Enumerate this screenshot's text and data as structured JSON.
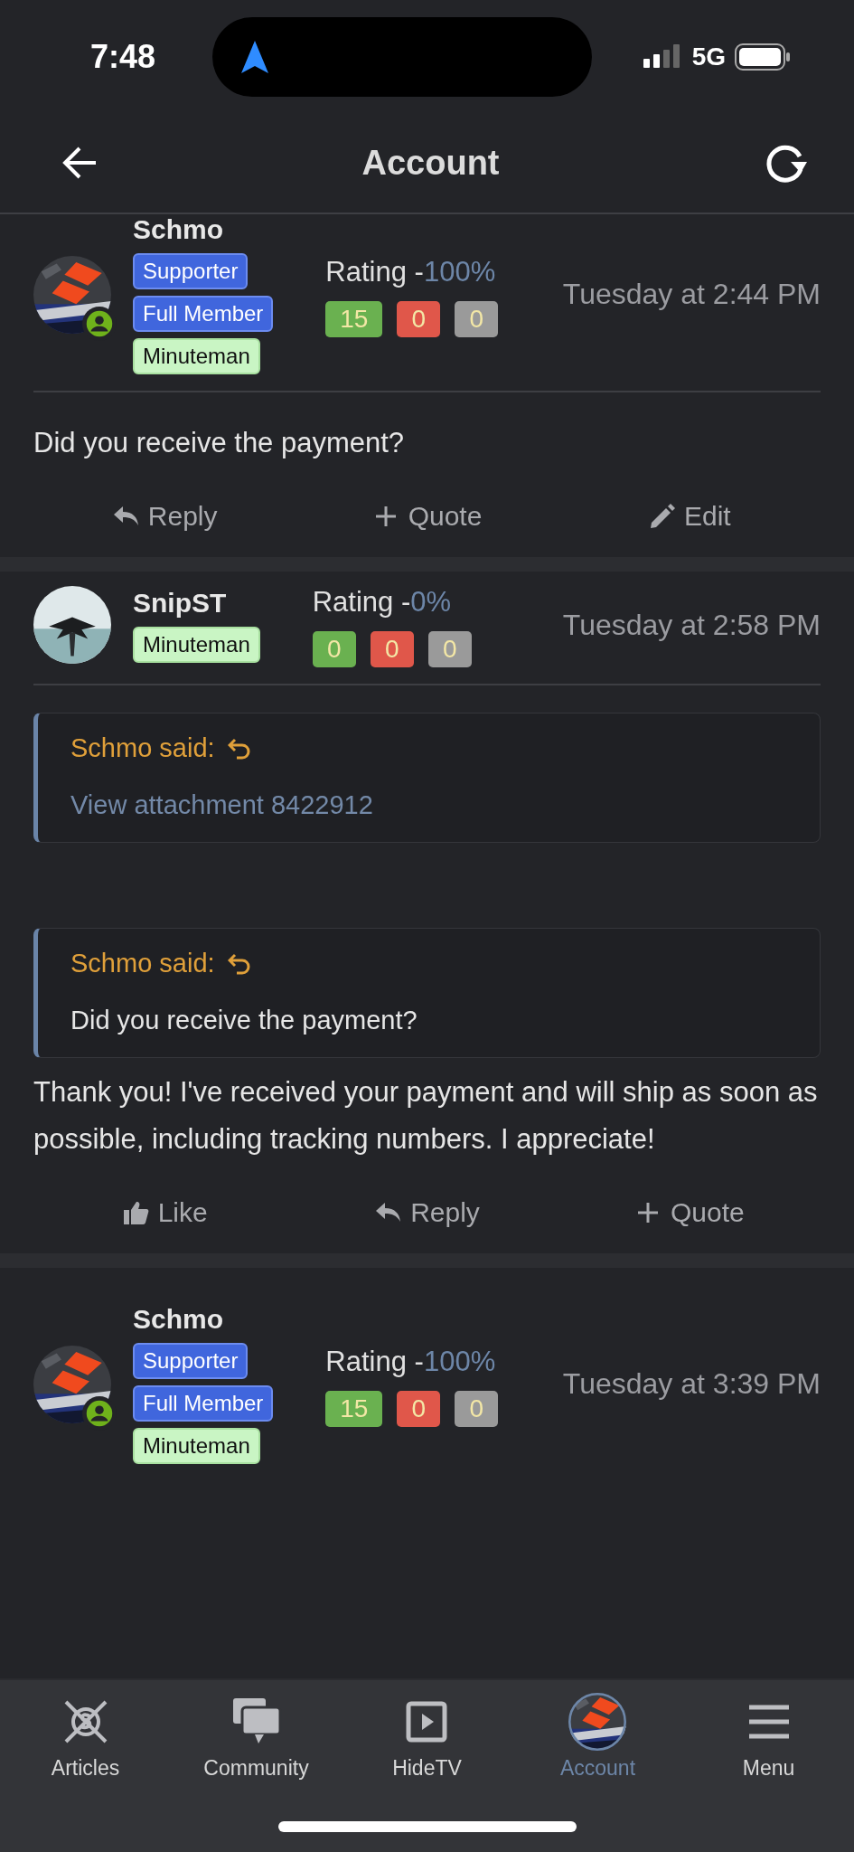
{
  "status_bar": {
    "time": "7:48",
    "network": "5G"
  },
  "header": {
    "title": "Account"
  },
  "posts": [
    {
      "author": "Schmo",
      "online": true,
      "badges": [
        {
          "label": "Supporter",
          "kind": "primary"
        },
        {
          "label": "Full Member",
          "kind": "primary"
        },
        {
          "label": "Minuteman",
          "kind": "light"
        }
      ],
      "rating": {
        "label": "Rating -",
        "value": "100%"
      },
      "counts": [
        {
          "value": "15",
          "kind": "positive"
        },
        {
          "value": "0",
          "kind": "negative"
        },
        {
          "value": "0",
          "kind": "neutral"
        }
      ],
      "time": "Tuesday at 2:44 PM",
      "body": [
        {
          "kind": "text",
          "text": "Did you receive the payment?"
        }
      ],
      "actions": [
        {
          "label": "Reply",
          "kind": "reply"
        },
        {
          "label": "Quote",
          "kind": "quote"
        },
        {
          "label": "Edit",
          "kind": "edit"
        }
      ]
    },
    {
      "author": "SnipST",
      "online": false,
      "badges": [
        {
          "label": "Minuteman",
          "kind": "light"
        }
      ],
      "rating": {
        "label": "Rating -",
        "value": "0%"
      },
      "counts": [
        {
          "value": "0",
          "kind": "positive"
        },
        {
          "value": "0",
          "kind": "negative"
        },
        {
          "value": "0",
          "kind": "neutral"
        }
      ],
      "time": "Tuesday at 2:58 PM",
      "body": [
        {
          "kind": "quote",
          "author": "Schmo said:",
          "link": "View attachment 8422912"
        },
        {
          "kind": "spacer"
        },
        {
          "kind": "quote",
          "author": "Schmo said:",
          "text": "Did you receive the payment?"
        },
        {
          "kind": "text",
          "text": "Thank you! I've received your payment and will ship as soon as possible, including tracking numbers. I appreciate!"
        }
      ],
      "actions": [
        {
          "label": "Like",
          "kind": "like"
        },
        {
          "label": "Reply",
          "kind": "reply"
        },
        {
          "label": "Quote",
          "kind": "quote"
        }
      ]
    },
    {
      "author": "Schmo",
      "online": true,
      "badges": [
        {
          "label": "Supporter",
          "kind": "primary"
        },
        {
          "label": "Full Member",
          "kind": "primary"
        },
        {
          "label": "Minuteman",
          "kind": "light"
        }
      ],
      "rating": {
        "label": "Rating -",
        "value": "100%"
      },
      "counts": [
        {
          "value": "15",
          "kind": "positive"
        },
        {
          "value": "0",
          "kind": "negative"
        },
        {
          "value": "0",
          "kind": "neutral"
        }
      ],
      "time": "Tuesday at 3:39 PM"
    }
  ],
  "tab_bar": [
    {
      "label": "Articles",
      "kind": "articles",
      "selected": false
    },
    {
      "label": "Community",
      "kind": "community",
      "selected": false
    },
    {
      "label": "HideTV",
      "kind": "video",
      "selected": false
    },
    {
      "label": "Account",
      "kind": "account",
      "selected": true
    },
    {
      "label": "Menu",
      "kind": "menu",
      "selected": false
    }
  ]
}
